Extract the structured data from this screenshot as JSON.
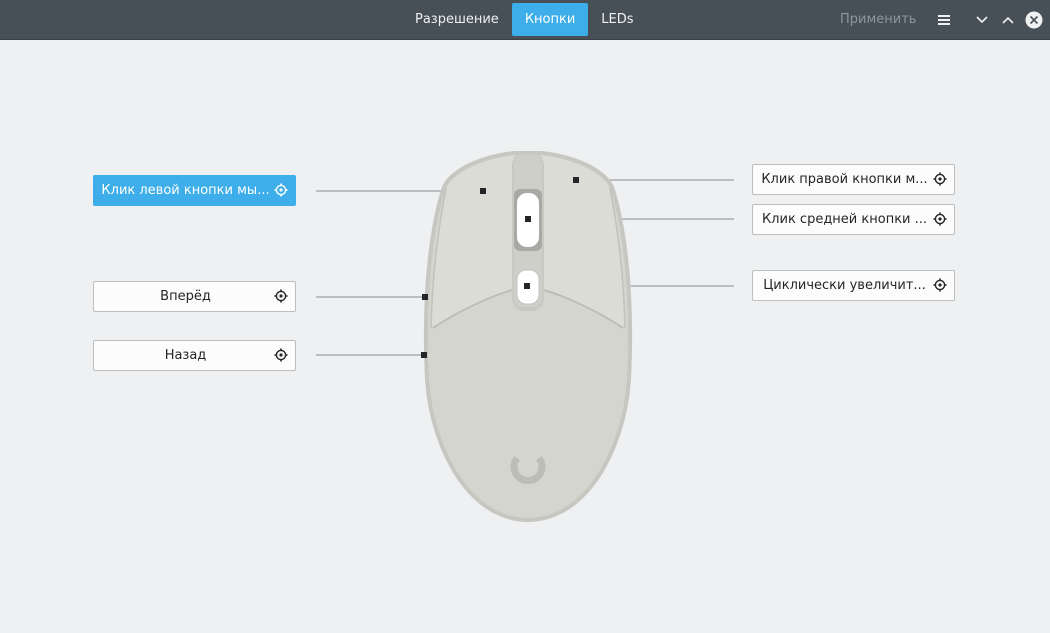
{
  "header": {
    "tabs": [
      {
        "label": "Разрешение",
        "active": false
      },
      {
        "label": "Кнопки",
        "active": true
      },
      {
        "label": "LEDs",
        "active": false
      }
    ],
    "apply_label": "Применить",
    "icons": [
      "hamburger-menu-icon",
      "minimize-icon",
      "maximize-icon",
      "close-icon"
    ]
  },
  "buttons": {
    "left_click": "Клик левой кнопки мы...",
    "forward": "Вперёд",
    "back": "Назад",
    "right_click": "Клик правой кнопки м...",
    "middle_click": "Клик средней кнопки ...",
    "cycle": "Циклически увеличит..."
  },
  "colors": {
    "header_bg": "#475057",
    "accent": "#3daee9",
    "window_bg": "#eff0f1",
    "mouse_body": "#d8d8d4"
  }
}
